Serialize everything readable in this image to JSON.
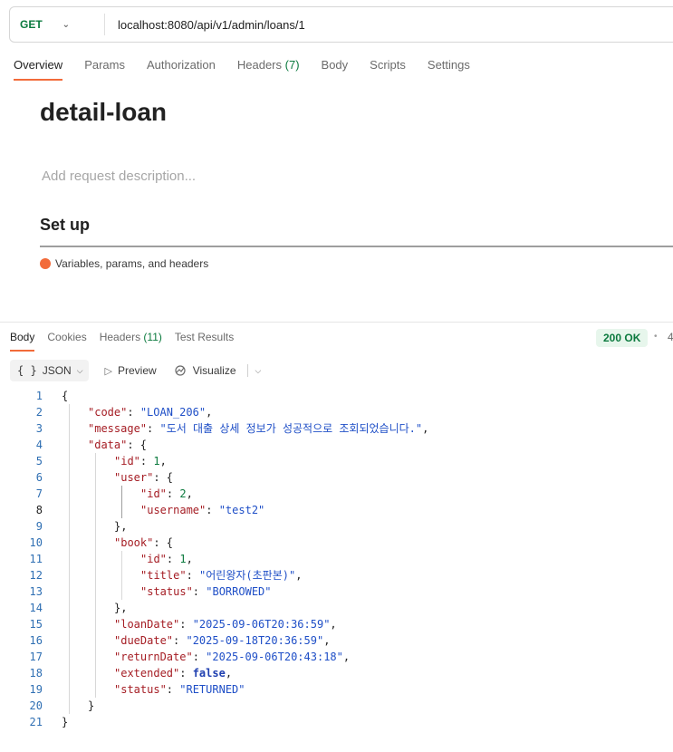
{
  "request": {
    "method": "GET",
    "url": "localhost:8080/api/v1/admin/loans/1",
    "tabs": [
      {
        "label": "Overview",
        "active": true
      },
      {
        "label": "Params"
      },
      {
        "label": "Authorization"
      },
      {
        "label": "Headers",
        "count": "(7)"
      },
      {
        "label": "Body"
      },
      {
        "label": "Scripts"
      },
      {
        "label": "Settings"
      }
    ]
  },
  "overview": {
    "title": "detail-loan",
    "description_placeholder": "Add request description...",
    "setup_heading": "Set up",
    "setup_item": "Variables, params, and headers"
  },
  "response": {
    "tabs": [
      {
        "label": "Body",
        "active": true
      },
      {
        "label": "Cookies"
      },
      {
        "label": "Headers",
        "count": "(11)"
      },
      {
        "label": "Test Results"
      }
    ],
    "status": "200 OK",
    "meta_truncated": "4",
    "toolbar": {
      "format_braces": "{ }",
      "format": "JSON",
      "preview": "Preview",
      "visualize": "Visualize"
    },
    "lines": [
      {
        "n": "1",
        "text": "{"
      },
      {
        "n": "2",
        "key": "\"code\"",
        "val": "\"LOAN_206\"",
        "type": "s",
        "trail": ","
      },
      {
        "n": "3",
        "key": "\"message\"",
        "val": "\"도서 대출 상세 정보가 성공적으로 조회되었습니다.\"",
        "type": "s",
        "trail": ","
      },
      {
        "n": "4",
        "key": "\"data\"",
        "trail": ": {"
      },
      {
        "n": "5",
        "key": "\"id\"",
        "val": "1",
        "type": "n",
        "trail": ","
      },
      {
        "n": "6",
        "key": "\"user\"",
        "trail": ": {"
      },
      {
        "n": "7",
        "key": "\"id\"",
        "val": "2",
        "type": "n",
        "trail": ","
      },
      {
        "n": "8",
        "key": "\"username\"",
        "val": "\"test2\"",
        "type": "s",
        "trail": ""
      },
      {
        "n": "9",
        "text": "},"
      },
      {
        "n": "10",
        "key": "\"book\"",
        "trail": ": {"
      },
      {
        "n": "11",
        "key": "\"id\"",
        "val": "1",
        "type": "n",
        "trail": ","
      },
      {
        "n": "12",
        "key": "\"title\"",
        "val": "\"어린왕자(초판본)\"",
        "type": "s",
        "trail": ","
      },
      {
        "n": "13",
        "key": "\"status\"",
        "val": "\"BORROWED\"",
        "type": "s",
        "trail": ""
      },
      {
        "n": "14",
        "text": "},"
      },
      {
        "n": "15",
        "key": "\"loanDate\"",
        "val": "\"2025-09-06T20:36:59\"",
        "type": "s",
        "trail": ","
      },
      {
        "n": "16",
        "key": "\"dueDate\"",
        "val": "\"2025-09-18T20:36:59\"",
        "type": "s",
        "trail": ","
      },
      {
        "n": "17",
        "key": "\"returnDate\"",
        "val": "\"2025-09-06T20:43:18\"",
        "type": "s",
        "trail": ","
      },
      {
        "n": "18",
        "key": "\"extended\"",
        "val": "false",
        "type": "b",
        "trail": ","
      },
      {
        "n": "19",
        "key": "\"status\"",
        "val": "\"RETURNED\"",
        "type": "s",
        "trail": ""
      },
      {
        "n": "20",
        "text": "}"
      },
      {
        "n": "21",
        "text": "}"
      }
    ]
  },
  "colors": {
    "accent": "#f26b3a",
    "success": "#0b7a3e",
    "json_key": "#a51d24",
    "json_string": "#1f4fc7"
  }
}
